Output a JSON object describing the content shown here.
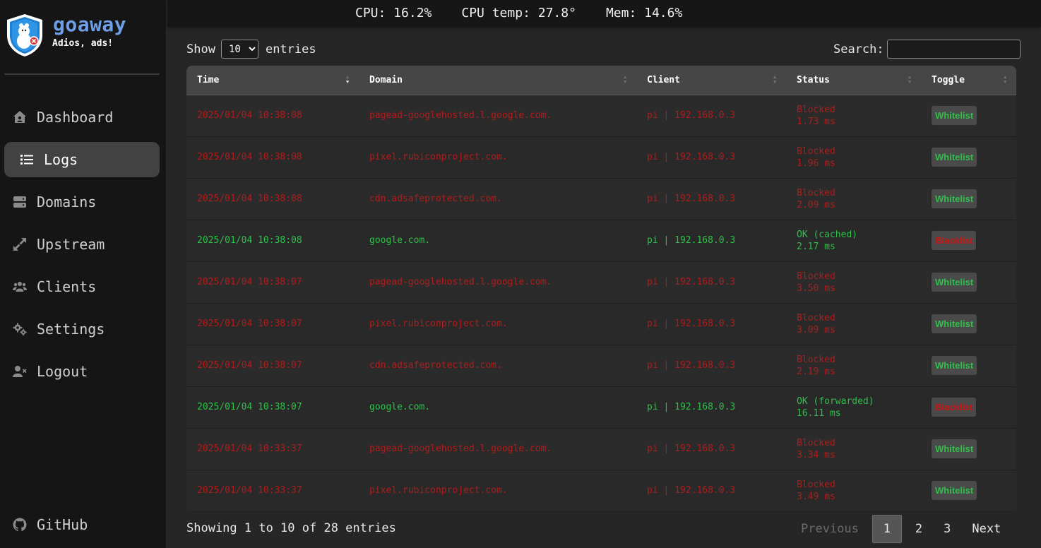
{
  "app": {
    "name": "goaway",
    "tagline": "Adios, ads!"
  },
  "topbar": {
    "cpu": "CPU: 16.2%",
    "cpu_temp": "CPU temp: 27.8°",
    "mem": "Mem: 14.6%"
  },
  "sidebar": {
    "items": [
      {
        "label": "Dashboard",
        "icon": "house-icon"
      },
      {
        "label": "Logs",
        "icon": "list-icon",
        "active": true
      },
      {
        "label": "Domains",
        "icon": "server-icon"
      },
      {
        "label": "Upstream",
        "icon": "arrows-expand-icon"
      },
      {
        "label": "Clients",
        "icon": "users-icon"
      },
      {
        "label": "Settings",
        "icon": "gears-icon"
      },
      {
        "label": "Logout",
        "icon": "user-x-icon"
      }
    ],
    "github": "GitHub"
  },
  "controls": {
    "show_label": "Show",
    "entries_label": "entries",
    "page_size": "10",
    "page_size_options": [
      "10"
    ],
    "search_label": "Search:",
    "search_value": ""
  },
  "table": {
    "columns": [
      "Time",
      "Domain",
      "Client",
      "Status",
      "Toggle"
    ],
    "rows": [
      {
        "time": "2025/01/04 10:38:08",
        "domain": "pagead-googlehosted.l.google.com.",
        "client": "pi | 192.168.0.3",
        "status": "Blocked",
        "latency": "1.73 ms",
        "toggle": "Whitelist",
        "state": "blocked"
      },
      {
        "time": "2025/01/04 10:38:08",
        "domain": "pixel.rubiconproject.com.",
        "client": "pi | 192.168.0.3",
        "status": "Blocked",
        "latency": "1.96 ms",
        "toggle": "Whitelist",
        "state": "blocked"
      },
      {
        "time": "2025/01/04 10:38:08",
        "domain": "cdn.adsafeprotected.com.",
        "client": "pi | 192.168.0.3",
        "status": "Blocked",
        "latency": "2.09 ms",
        "toggle": "Whitelist",
        "state": "blocked"
      },
      {
        "time": "2025/01/04 10:38:08",
        "domain": "google.com.",
        "client": "pi | 192.168.0.3",
        "status": "OK (cached)",
        "latency": "2.17 ms",
        "toggle": "Blacklist",
        "state": "ok"
      },
      {
        "time": "2025/01/04 10:38:07",
        "domain": "pagead-googlehosted.l.google.com.",
        "client": "pi | 192.168.0.3",
        "status": "Blocked",
        "latency": "3.50 ms",
        "toggle": "Whitelist",
        "state": "blocked"
      },
      {
        "time": "2025/01/04 10:38:07",
        "domain": "pixel.rubiconproject.com.",
        "client": "pi | 192.168.0.3",
        "status": "Blocked",
        "latency": "3.09 ms",
        "toggle": "Whitelist",
        "state": "blocked"
      },
      {
        "time": "2025/01/04 10:38:07",
        "domain": "cdn.adsafeprotected.com.",
        "client": "pi | 192.168.0.3",
        "status": "Blocked",
        "latency": "2.19 ms",
        "toggle": "Whitelist",
        "state": "blocked"
      },
      {
        "time": "2025/01/04 10:38:07",
        "domain": "google.com.",
        "client": "pi | 192.168.0.3",
        "status": "OK (forwarded)",
        "latency": "16.11 ms",
        "toggle": "Blacklist",
        "state": "ok"
      },
      {
        "time": "2025/01/04 10:33:37",
        "domain": "pagead-googlehosted.l.google.com.",
        "client": "pi | 192.168.0.3",
        "status": "Blocked",
        "latency": "3.34 ms",
        "toggle": "Whitelist",
        "state": "blocked"
      },
      {
        "time": "2025/01/04 10:33:37",
        "domain": "pixel.rubiconproject.com.",
        "client": "pi | 192.168.0.3",
        "status": "Blocked",
        "latency": "3.49 ms",
        "toggle": "Whitelist",
        "state": "blocked"
      }
    ]
  },
  "footer": {
    "info": "Showing 1 to 10 of 28 entries",
    "previous": "Previous",
    "pages": [
      "1",
      "2",
      "3"
    ],
    "next": "Next"
  },
  "colors": {
    "accent": "#6d9ee6",
    "blocked": "#b01c1c",
    "ok": "#2fbf4a"
  }
}
